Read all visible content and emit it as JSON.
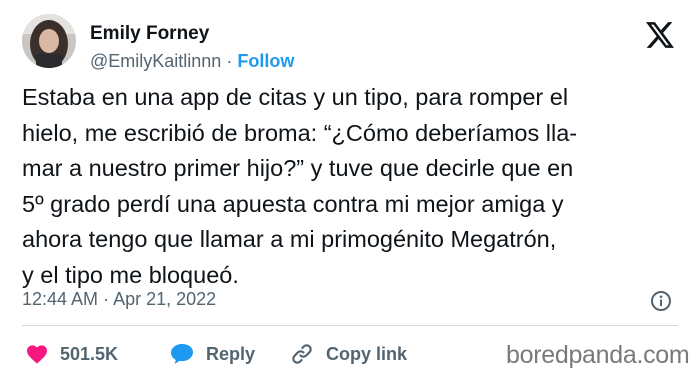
{
  "header": {
    "name": "Emily Forney",
    "handle": "@EmilyKaitlinnn",
    "separator": "·",
    "follow_label": "Follow"
  },
  "tweet": {
    "lines": [
      "Estaba en una app de citas y un tipo, para romper el",
      "hielo, me escribió de broma: “¿Cómo deberíamos lla-",
      "mar a nuestro primer hijo?” y tuve que decirle que en",
      "5º grado perdí una apuesta contra mi mejor amiga y",
      "ahora tengo que llamar a mi primogénito Megatrón,",
      "y el tipo me bloqueó."
    ],
    "time": "12:44 AM",
    "date": "Apr 21, 2022"
  },
  "actions": {
    "likes_count": "501.5K",
    "reply_label": "Reply",
    "copy_link_label": "Copy link"
  },
  "watermark": "boredpanda.com",
  "colors": {
    "like_red": "#f91880",
    "reply_blue": "#1d9bf0",
    "follow_blue": "#1d9bf0",
    "secondary_text": "#536471",
    "divider": "#cfd9de"
  },
  "icons": [
    "x-logo-icon",
    "info-icon",
    "heart-icon",
    "reply-bubble-icon",
    "link-icon"
  ]
}
